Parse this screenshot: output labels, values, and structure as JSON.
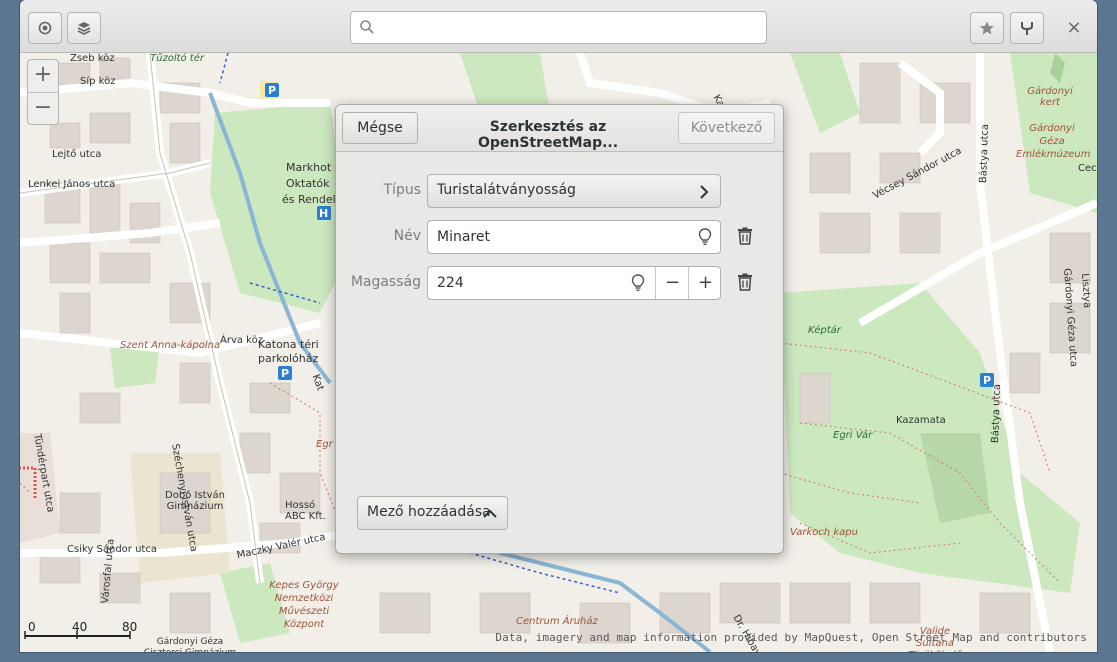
{
  "window": {
    "search": {
      "value": "",
      "placeholder": ""
    },
    "header_icons": [
      "location-icon",
      "layers-icon",
      "star-icon",
      "route-icon",
      "close-icon"
    ],
    "close_glyph": "×"
  },
  "map": {
    "zoom_in": "+",
    "zoom_out": "−",
    "scale_labels": [
      "0",
      "40",
      "80"
    ],
    "attribution": "Data, imagery and map information provided by MapQuest, Open Street Map and contributors",
    "labels": {
      "zseb": "Zseb köz",
      "sip": "Síp köz",
      "tuzolto": "Tűzoltó tér",
      "lejto": "Lejtő utca",
      "lenkei": "Lenkei János utca",
      "markhot": "Markhot F",
      "oktato": "Oktatók",
      "rendelo": "és Rendel",
      "szent_anna": "Szent Anna-kápolna",
      "arva": "Árva köz",
      "katona": "Katona téri",
      "parkolohaz": "parkolóház",
      "szechenyi": "Széchenyi István utca",
      "tunderpart": "Tündérpart utca",
      "dobo": "Dobó István Gimnázium",
      "hosso": "Hossó ABC Kft.",
      "maczky": "Maczky Valér utca",
      "csiky": "Csiky Sándor utca",
      "kepes": "Kepes György Nemzetközi Művészeti Központ",
      "gardonyi_gim": "Gárdonyi Géza Ciszterci Gimnázium Szakközépiskola",
      "varosfal": "Városfal utca",
      "centrum": "Centrum Áruház",
      "valide": "Valide Sultana Törökfürdő",
      "gardonyi_kert": "Gárdonyi kert",
      "gardonyi_muzeum": "Gárdonyi Géza Emlékmúzeum",
      "vecsey": "Vécsey Sándor utca",
      "bastya": "Bástya utca",
      "bastya2": "Bástya utca",
      "keptar": "Képtár",
      "kazamata": "Kazamata",
      "egri_var": "Egri Vár",
      "varkoch": "Varkoch kapu",
      "gardonyi_utca": "Gárdonyi Géza utca",
      "lisztya": "Lisztya",
      "egr": "Egr",
      "cece": "Cece",
      "kat": "Kat",
      "dr": "Dr. Hibay K"
    }
  },
  "dialog": {
    "cancel": "Mégse",
    "title": "Szerkesztés az OpenStreetMap...",
    "next": "Következő",
    "fields": {
      "type_label": "Típus",
      "type_value": "Turistalátványosság",
      "name_label": "Név",
      "name_value": "Minaret",
      "height_label": "Magasság",
      "height_value": "224",
      "minus": "−",
      "plus": "+"
    },
    "add_field": "Mező hozzáadása"
  }
}
